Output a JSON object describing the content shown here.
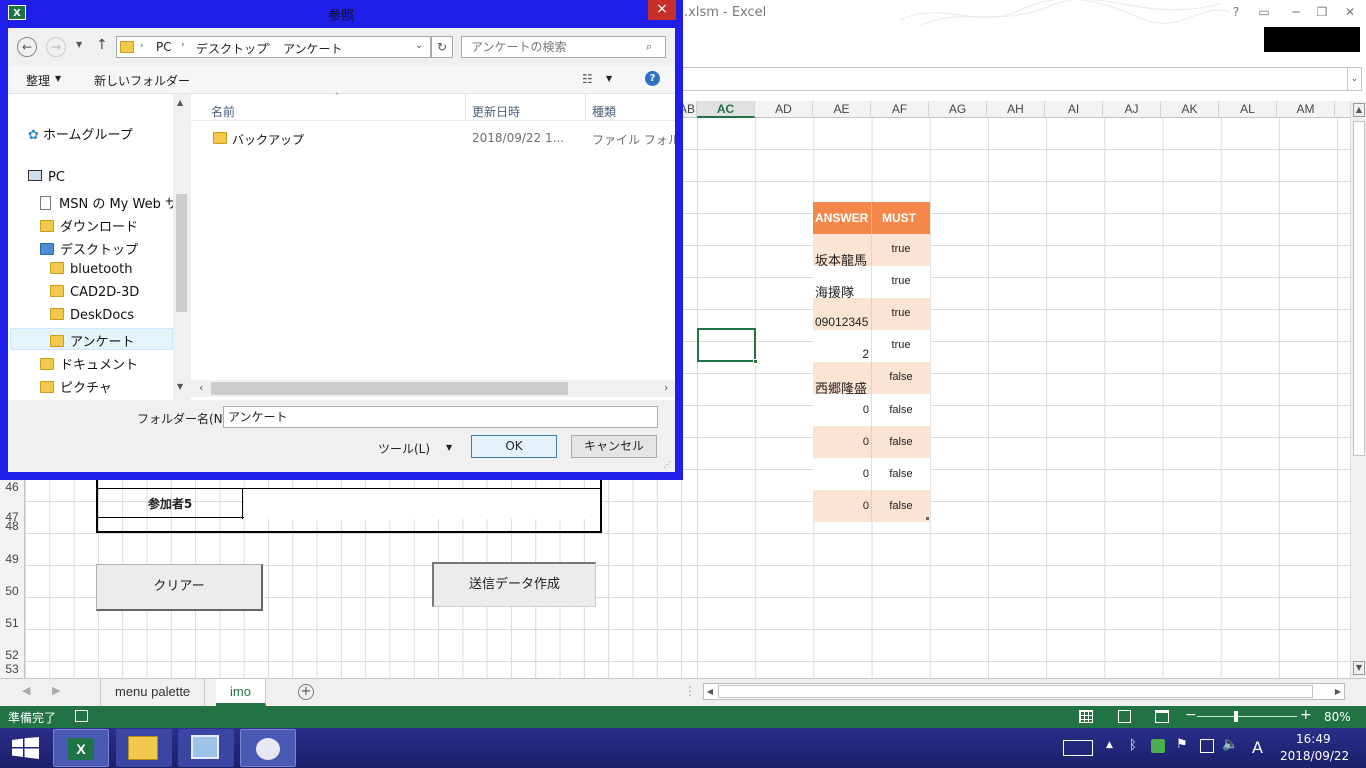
{
  "excel": {
    "title": ".xlsm - Excel",
    "help_label": "?",
    "columns": [
      "AB",
      "AC",
      "AD",
      "AE",
      "AF",
      "AG",
      "AH",
      "AI",
      "AJ",
      "AK",
      "AL",
      "AM"
    ],
    "selected_column": "AC",
    "rows": [
      "46",
      "47",
      "48",
      "49",
      "50",
      "51",
      "52",
      "53"
    ]
  },
  "answer_table": {
    "headers": [
      "ANSWER",
      "MUST"
    ],
    "rows": [
      {
        "answer": "坂本龍馬",
        "must": "true"
      },
      {
        "answer": "海援隊",
        "must": "true"
      },
      {
        "answer": "09012345",
        "must": "true"
      },
      {
        "answer": "2",
        "must": "true"
      },
      {
        "answer": "西郷隆盛",
        "must": "false"
      },
      {
        "answer": "0",
        "must": "false"
      },
      {
        "answer": "0",
        "must": "false"
      },
      {
        "answer": "0",
        "must": "false"
      },
      {
        "answer": "0",
        "must": "false"
      }
    ]
  },
  "form": {
    "participant5_label": "参加者5",
    "clear_button": "クリアー",
    "create_send_data_button": "送信データ作成"
  },
  "sheet_tabs": {
    "tabs": [
      "menu palette",
      "imo"
    ],
    "active": "imo",
    "add_label": "+"
  },
  "statusbar": {
    "status": "準備完了",
    "zoom": "80%",
    "zoom_level_percent": 80
  },
  "taskbar": {
    "time": "16:49",
    "date": "2018/09/22",
    "ime": "A"
  },
  "dialog": {
    "title": "参照",
    "close_label": "×",
    "breadcrumb": [
      "PC",
      "デスクトップ",
      "アンケート"
    ],
    "search_placeholder": "アンケートの検索",
    "organize_label": "整理",
    "new_folder_label": "新しいフォルダー",
    "nav_tree": {
      "homegroup": "ホームグループ",
      "pc": "PC",
      "msn": "MSN の My Web サ",
      "downloads": "ダウンロード",
      "desktop": "デスクトップ",
      "bluetooth": "bluetooth",
      "cad": "CAD2D-3D",
      "deskdocs": "DeskDocs",
      "survey": "アンケート",
      "documents": "ドキュメント",
      "pictures": "ピクチャ"
    },
    "columns": {
      "name": "名前",
      "date": "更新日時",
      "type": "種類"
    },
    "files": [
      {
        "name": "バックアップ",
        "date": "2018/09/22 1...",
        "type": "ファイル フォルダー"
      }
    ],
    "folder_name_label": "フォルダー名(N):",
    "folder_name_value": "アンケート",
    "tools_label": "ツール(L)",
    "ok_label": "OK",
    "cancel_label": "キャンセル"
  }
}
